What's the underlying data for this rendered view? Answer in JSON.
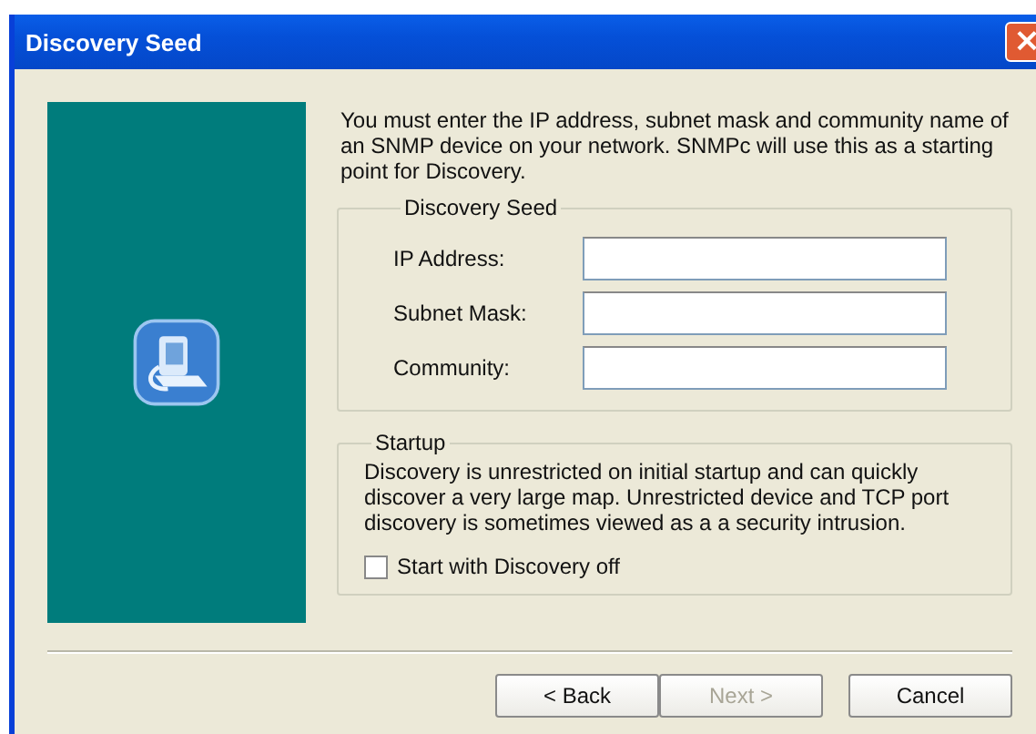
{
  "window": {
    "title": "Discovery Seed",
    "close": "×"
  },
  "intro": "You must enter the IP address, subnet mask and community name of an SNMP device on your network. SNMPc will use this as a starting point for Discovery.",
  "seed_group": {
    "title": "Discovery Seed",
    "fields": [
      {
        "label": "IP Address:"
      },
      {
        "label": "Subnet Mask:"
      },
      {
        "label": "Community:"
      }
    ]
  },
  "startup_group": {
    "title": "Startup",
    "text": "Discovery is unrestricted on initial startup and can quickly discover a very large map.  Unrestricted device and TCP port discovery is sometimes viewed as a a security intrusion.",
    "checkbox": {
      "label": "Start with Discovery off",
      "checked": false
    }
  },
  "buttons": [
    {
      "label": "< Back",
      "disabled": false
    },
    {
      "label": "Next >",
      "disabled": true
    },
    {
      "label": "Cancel",
      "disabled": false
    }
  ]
}
